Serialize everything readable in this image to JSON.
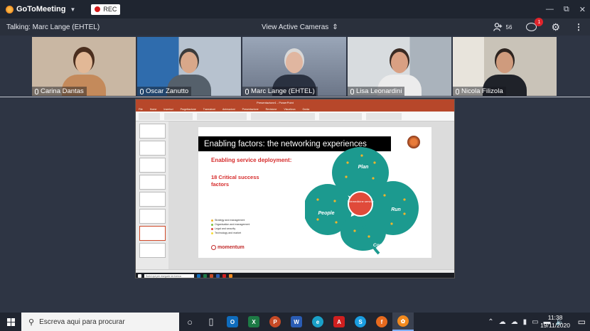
{
  "titlebar": {
    "app_name": "GoToMeeting",
    "rec_label": "REC",
    "min_glyph": "—",
    "restore_glyph": "⧉",
    "close_glyph": "✕"
  },
  "toolbar": {
    "talking": "Talking: Marc Lange (EHTEL)",
    "view": "View Active Cameras",
    "attendee_count": "56",
    "chat_badge": "1"
  },
  "cameras": [
    {
      "name": "Carina Dantas",
      "bg": "#c9b7a3",
      "skin": "#e2b896",
      "hair": "#4a2e1e",
      "shirt": "#c48a5b"
    },
    {
      "name": "Oscar Zanutto",
      "bg": "#7a8796",
      "skin": "#d9a88a",
      "hair": "#3b3b3b",
      "shirt": "#55606b"
    },
    {
      "name": "Marc Lange (EHTEL)",
      "bg": "#8a94a6",
      "skin": "#e0b6a0",
      "hair": "#d8d8d8",
      "shirt": "#2a3140"
    },
    {
      "name": "Lisa Leonardini",
      "bg": "#c7ccd1",
      "skin": "#d9a083",
      "hair": "#3a2b24",
      "shirt": "#ececec"
    },
    {
      "name": "Nicola Filizola",
      "bg": "#d9d4cc",
      "skin": "#cf9b7d",
      "hair": "#2d2420",
      "shirt": "#1f2229"
    }
  ],
  "share": {
    "doc_title": "Presentazione1 - PowerPoint",
    "menu": [
      "File",
      "Home",
      "Inserisci",
      "Progettazione",
      "Transizioni",
      "Animazioni",
      "Presentazione",
      "Revisione",
      "Visualizza",
      "Guida"
    ],
    "slide_title": "Enabling factors: the networking experiences",
    "slide_subtitle": "Enabling service deployment:",
    "critical_text": "18 Critical success factors",
    "legend": [
      {
        "text": "Strategy and management",
        "color": "#f2b52a"
      },
      {
        "text": "Organisation and management",
        "color": "#7cc242"
      },
      {
        "text": "Legal and security",
        "color": "#e04a3a"
      },
      {
        "text": "Technology and market",
        "color": "#f5dc3a"
      }
    ],
    "brand": "momentum",
    "clover_labels": {
      "plan": "Plan",
      "run": "Run",
      "people": "People",
      "context": "Context",
      "center": "Telemedicine service"
    },
    "taskbar_search": "Scrivi qui per eseguire la ricerca"
  },
  "taskbar": {
    "search_placeholder": "Escreva aqui para procurar",
    "time": "11:38",
    "date": "19/11/2020",
    "apps": [
      {
        "name": "outlook",
        "label": "O",
        "color": "#0f6cbd"
      },
      {
        "name": "excel",
        "label": "X",
        "color": "#1d7a45"
      },
      {
        "name": "powerpoint",
        "label": "P",
        "color": "#c64a26"
      },
      {
        "name": "word",
        "label": "W",
        "color": "#2a5cb4"
      },
      {
        "name": "edge",
        "label": "e",
        "color": "#1aa0c8"
      },
      {
        "name": "acrobat",
        "label": "A",
        "color": "#d01f1f"
      },
      {
        "name": "skype",
        "label": "S",
        "color": "#1a9de0"
      },
      {
        "name": "firefox",
        "label": "f",
        "color": "#e66a1e"
      },
      {
        "name": "gotomeeting",
        "label": "✿",
        "color": "#f28a1e"
      }
    ]
  }
}
